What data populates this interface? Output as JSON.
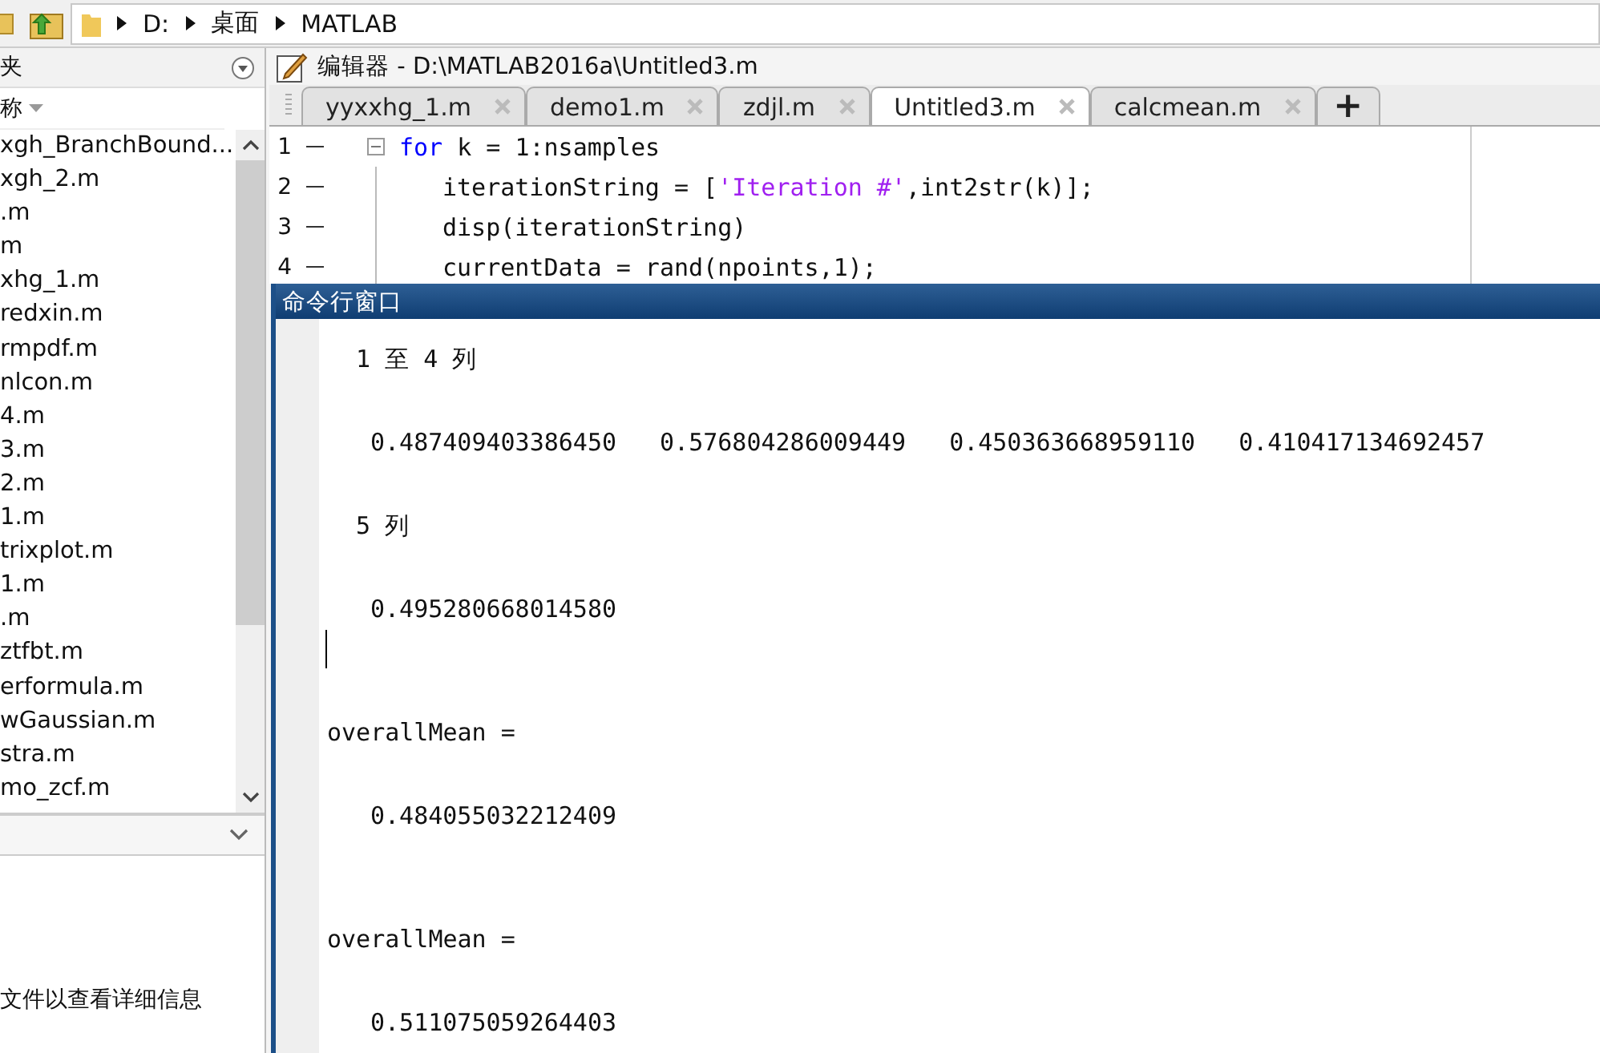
{
  "address_bar": {
    "crumbs": [
      "D:",
      "桌面",
      "MATLAB"
    ]
  },
  "file_browser": {
    "title": "夹",
    "column_header": "称",
    "files": [
      "xgh_BranchBound...",
      "xgh_2.m",
      ".m",
      "m",
      "xhg_1.m",
      "redxin.m",
      "rmpdf.m",
      "nlcon.m",
      "4.m",
      "3.m",
      "2.m",
      "1.m",
      "trixplot.m",
      "1.m",
      ".m",
      "ztfbt.m",
      "erformula.m",
      "wGaussian.m",
      "stra.m",
      "mo_zcf.m"
    ],
    "details_hint": "文件以查看详细信息"
  },
  "editor": {
    "title": "编辑器 - D:\\MATLAB2016a\\Untitled3.m",
    "tabs": [
      {
        "label": "yyxxhg_1.m",
        "selected": false
      },
      {
        "label": "demo1.m",
        "selected": false
      },
      {
        "label": "zdjl.m",
        "selected": false
      },
      {
        "label": "Untitled3.m",
        "selected": true
      },
      {
        "label": "calcmean.m",
        "selected": false
      }
    ],
    "new_tab": "+",
    "code": [
      {
        "number": "1",
        "tokens": [
          {
            "kind": "keyword",
            "text": "for"
          },
          {
            "kind": "plain",
            "text": "k = 1:nsamples"
          }
        ],
        "children": [
          {
            "number": "2",
            "tokens": [
              {
                "kind": "plain",
                "text": "iterationString = ["
              },
              {
                "kind": "string",
                "text": "'Iteration #'"
              },
              {
                "kind": "plain",
                "text": ",int2str(k)];"
              }
            ]
          },
          {
            "number": "3",
            "tokens": [
              {
                "kind": "plain",
                "text": "disp(iterationString)"
              }
            ]
          },
          {
            "number": "4",
            "tokens": [
              {
                "kind": "plain",
                "text": "currentData = rand(npoints,1);"
              }
            ]
          }
        ]
      }
    ]
  },
  "command_window": {
    "title": "命令行窗口",
    "lines": [
      {
        "kind": "header",
        "text": "1 至 4 列"
      },
      {
        "kind": "blank"
      },
      {
        "kind": "values",
        "values": [
          "0.487409403386450",
          "0.576804286009449",
          "0.450363668959110",
          "0.410417134692457"
        ]
      },
      {
        "kind": "blank"
      },
      {
        "kind": "header",
        "text": "5 列"
      },
      {
        "kind": "blank"
      },
      {
        "kind": "values",
        "values": [
          "0.495280668014580"
        ]
      },
      {
        "kind": "cursor"
      },
      {
        "kind": "blank"
      },
      {
        "kind": "variable",
        "text": "overallMean ="
      },
      {
        "kind": "blank"
      },
      {
        "kind": "values",
        "values": [
          "0.484055032212409"
        ]
      },
      {
        "kind": "blank"
      },
      {
        "kind": "blank"
      },
      {
        "kind": "variable",
        "text": "overallMean ="
      },
      {
        "kind": "blank"
      },
      {
        "kind": "values",
        "values": [
          "0.511075059264403"
        ]
      }
    ]
  }
}
